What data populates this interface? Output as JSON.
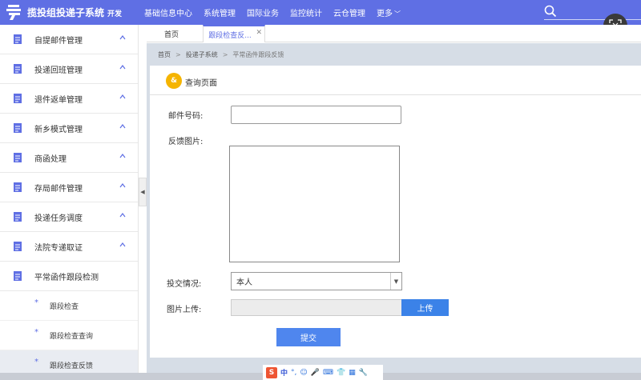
{
  "app": {
    "title": "揽投组投递子系统",
    "env": "开发",
    "brand_color": "#5f6fe4"
  },
  "menu": [
    {
      "label": "基础信息中心"
    },
    {
      "label": "系统管理"
    },
    {
      "label": "国际业务"
    },
    {
      "label": "监控统计"
    },
    {
      "label": "云仓管理"
    },
    {
      "label": "更多"
    }
  ],
  "sidebar": {
    "items": [
      {
        "label": "自提邮件管理",
        "icon": "document-icon"
      },
      {
        "label": "投递回班管理",
        "icon": "document-icon"
      },
      {
        "label": "退件返单管理",
        "icon": "document-icon"
      },
      {
        "label": "新乡模式管理",
        "icon": "document-icon"
      },
      {
        "label": "商函处理",
        "icon": "document-icon"
      },
      {
        "label": "存局邮件管理",
        "icon": "document-icon"
      },
      {
        "label": "投递任务调度",
        "icon": "document-icon"
      },
      {
        "label": "法院专递取证",
        "icon": "document-icon"
      },
      {
        "label": "平常函件跟段检测",
        "icon": "document-icon"
      }
    ],
    "subitems": [
      {
        "label": "跟段检查"
      },
      {
        "label": "跟段检查查询"
      },
      {
        "label": "跟段检查反馈"
      }
    ]
  },
  "tabs": {
    "home": "首页",
    "active": "跟段检查反..."
  },
  "breadcrumb": {
    "home": "首页",
    "system": "投递子系统",
    "current": "平常函件跟段反馈"
  },
  "panel": {
    "title": "查询页面",
    "icon_text": "&"
  },
  "form": {
    "mail_no_label": "邮件号码:",
    "mail_no_value": "",
    "feedback_image_label": "反馈图片:",
    "delivery_label": "投交情况:",
    "delivery_value": "本人",
    "upload_label": "图片上传:",
    "upload_button": "上传",
    "submit_button": "提交"
  },
  "ime": {
    "s": "S",
    "zh": "中",
    "punct": "°,"
  }
}
